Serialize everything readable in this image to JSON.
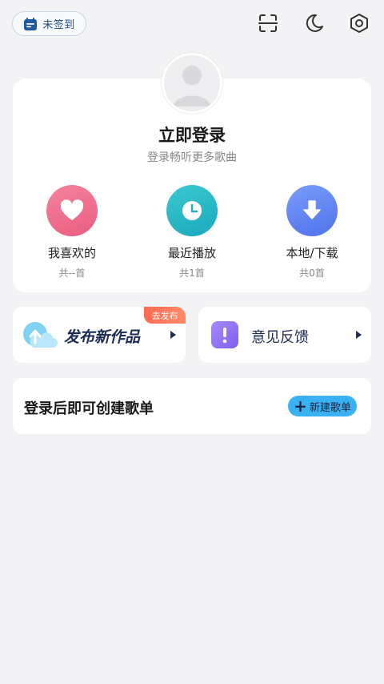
{
  "topbar": {
    "signin_label": "未签到",
    "icons": [
      "scan-icon",
      "moon-icon",
      "settings-icon"
    ]
  },
  "profile": {
    "title": "立即登录",
    "subtitle": "登录畅听更多歌曲"
  },
  "quick_actions": [
    {
      "label": "我喜欢的",
      "sub": "共--首",
      "icon": "heart-icon",
      "color": "#f0708e"
    },
    {
      "label": "最近播放",
      "sub": "共1首",
      "icon": "clock-icon",
      "color": "#27b9c6"
    },
    {
      "label": "本地/下载",
      "sub": "共0首",
      "icon": "download-icon",
      "color": "#5e86f4"
    }
  ],
  "publish": {
    "text": "发布新作品",
    "badge": "去发布"
  },
  "feedback": {
    "text": "意见反馈"
  },
  "playlist": {
    "text": "登录后即可创建歌单",
    "button": "新建歌单"
  }
}
